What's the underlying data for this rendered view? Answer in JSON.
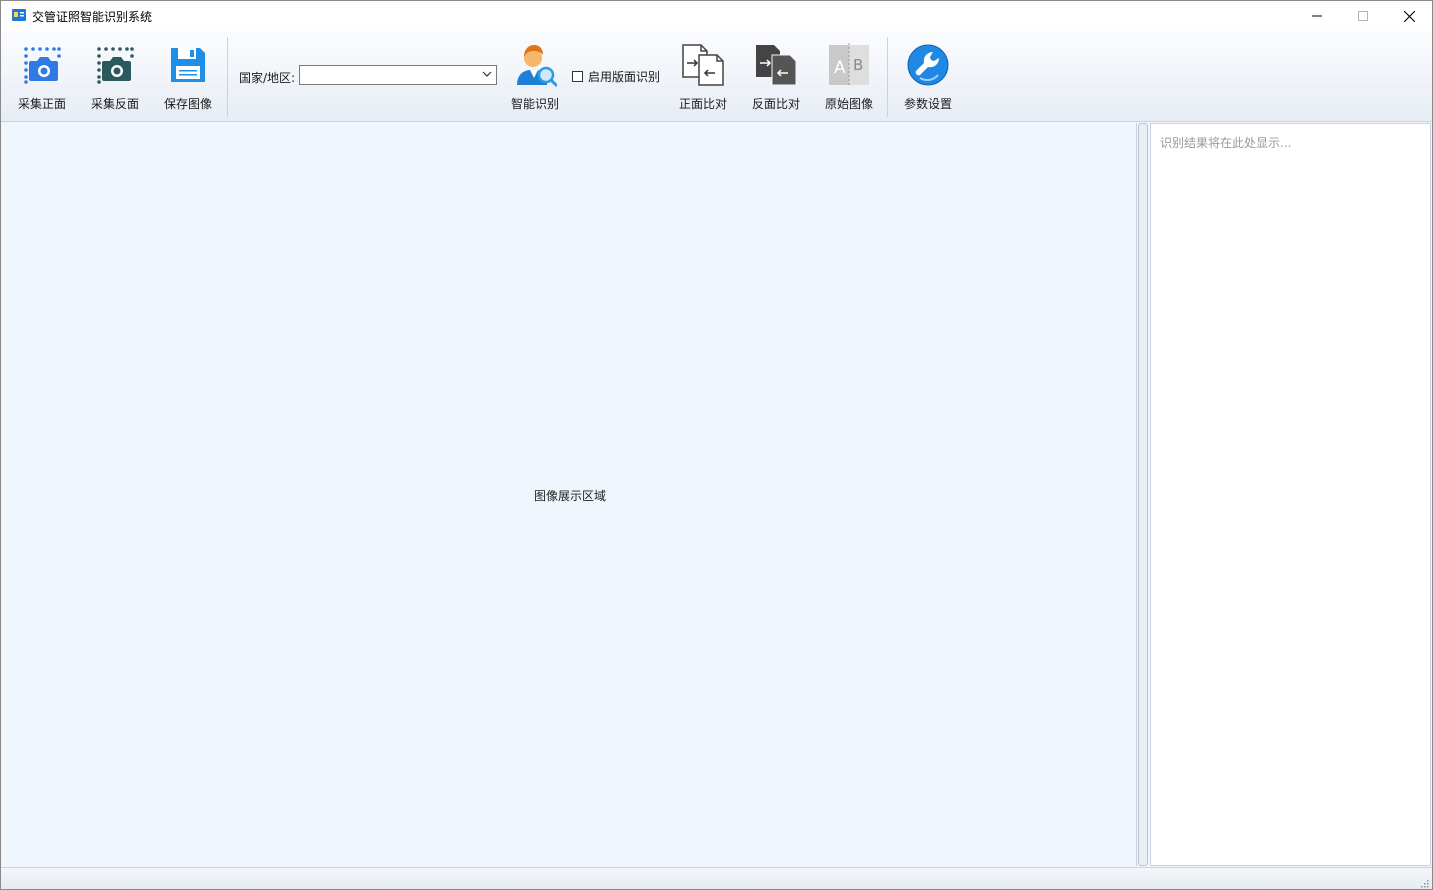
{
  "window": {
    "title": "交管证照智能识别系统",
    "controls": {
      "minimize": "minimize",
      "maximize": "maximize",
      "close": "close"
    }
  },
  "toolbar": {
    "capture_front": {
      "label": "采集正面",
      "icon": "camera-front-icon",
      "color": "#2f7be3"
    },
    "capture_back": {
      "label": "采集反面",
      "icon": "camera-back-icon",
      "color": "#2b5a5e"
    },
    "save_image": {
      "label": "保存图像",
      "icon": "save-icon",
      "color": "#1e8fe8"
    },
    "country": {
      "label": "国家/地区:",
      "value": ""
    },
    "smart_recognize": {
      "label": "智能识别",
      "icon": "person-search-icon"
    },
    "layout_recognition": {
      "label": "启用版面识别",
      "checked": false
    },
    "front_compare": {
      "label": "正面比对",
      "icon": "document-compare-icon"
    },
    "back_compare": {
      "label": "反面比对",
      "icon": "document-compare-dark-icon"
    },
    "original_image": {
      "label": "原始图像",
      "icon": "ab-image-icon"
    },
    "settings": {
      "label": "参数设置",
      "icon": "wrench-settings-icon",
      "color": "#1f88e5"
    }
  },
  "main": {
    "image_area": {
      "placeholder": "图像展示区域"
    },
    "result_panel": {
      "placeholder": "识别结果将在此处显示..."
    }
  }
}
